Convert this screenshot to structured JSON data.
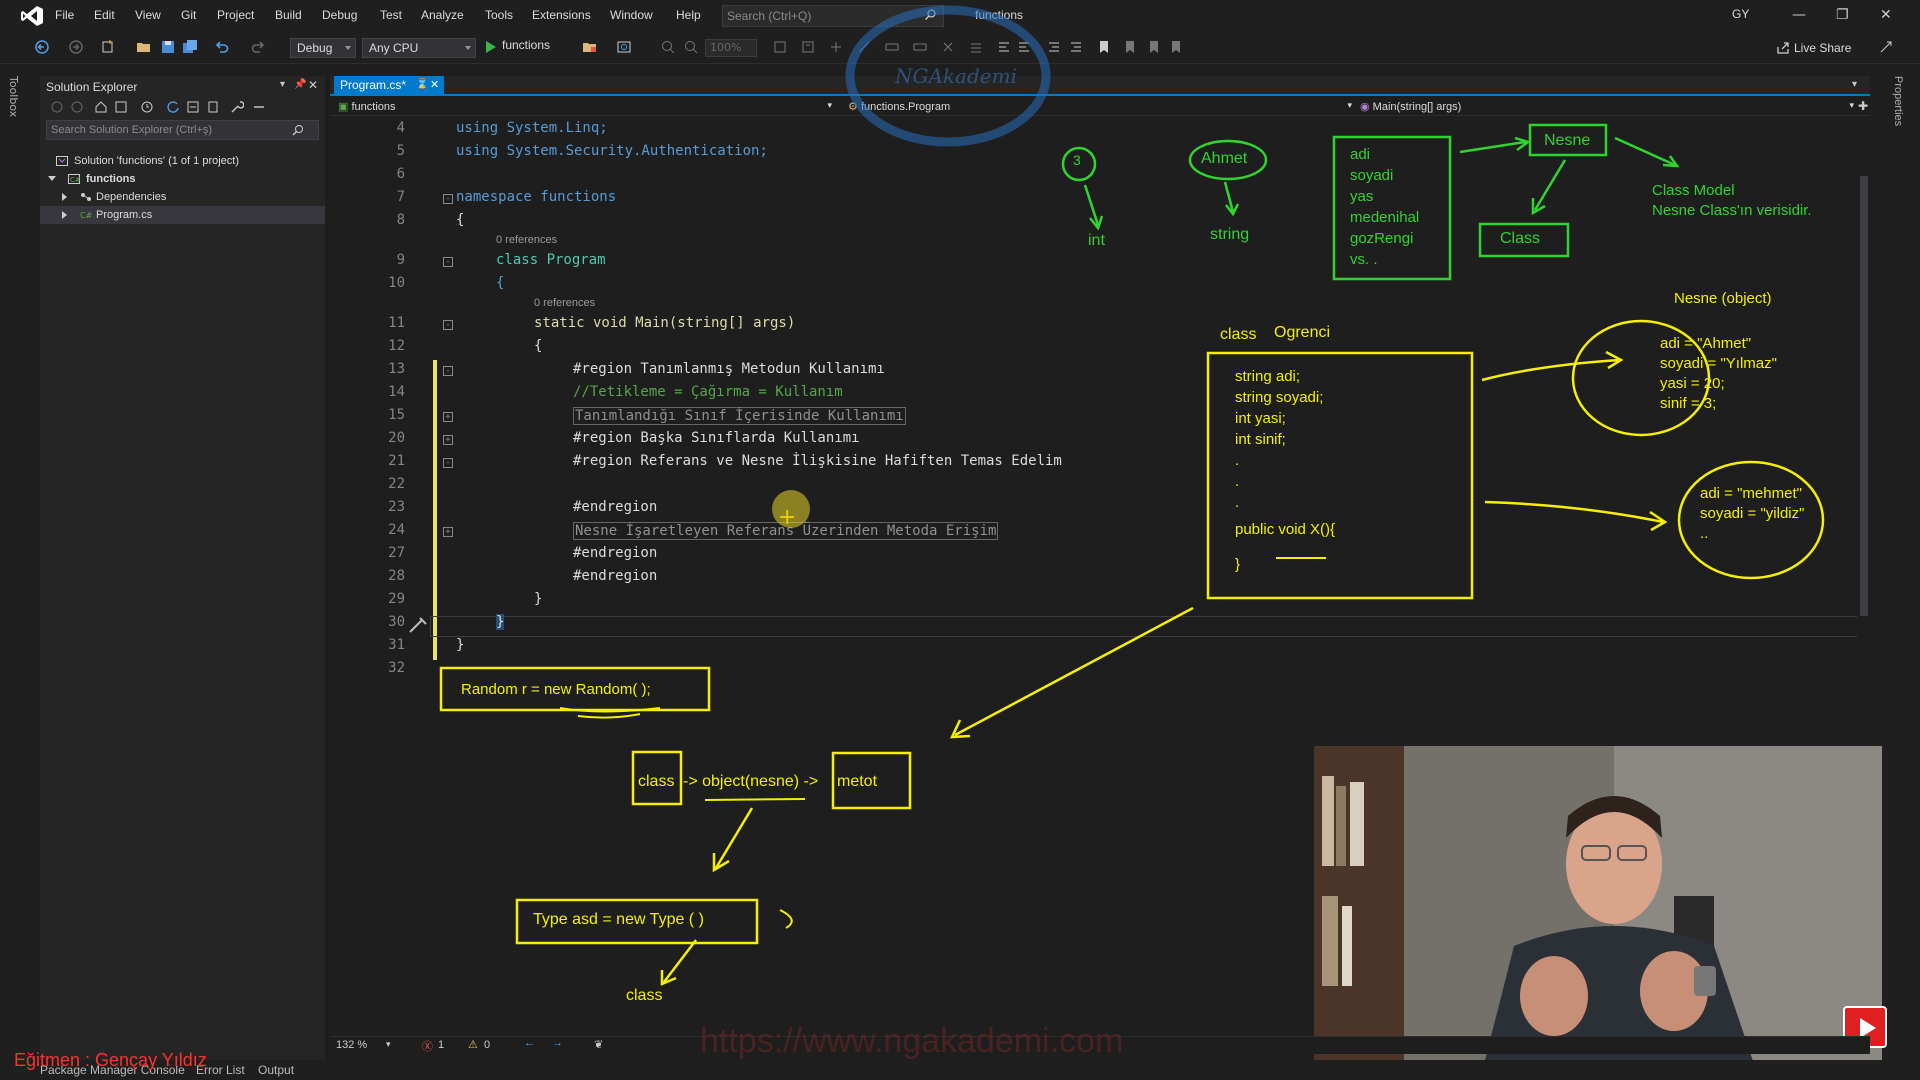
{
  "app": {
    "solution_name": "functions",
    "search_placeholder": "Search (Ctrl+Q)",
    "user_initials": "GY",
    "live_share": "Live Share"
  },
  "menu": [
    "File",
    "Edit",
    "View",
    "Git",
    "Project",
    "Build",
    "Debug",
    "Test",
    "Analyze",
    "Tools",
    "Extensions",
    "Window",
    "Help"
  ],
  "toolbar": {
    "config": "Debug",
    "platform": "Any CPU",
    "run_target": "functions",
    "zoom": "100%"
  },
  "sidebar": {
    "toolbox_label": "Toolbox",
    "properties_label": "Properties",
    "title": "Solution Explorer",
    "search_placeholder": "Search Solution Explorer (Ctrl+ş)",
    "tree": [
      {
        "label": "Solution 'functions' (1 of 1 project)"
      },
      {
        "label": "functions"
      },
      {
        "label": "Dependencies"
      },
      {
        "label": "Program.cs"
      }
    ]
  },
  "editor": {
    "tab": "Program.cs*",
    "nav_project": "functions",
    "nav_class": "functions.Program",
    "nav_member": "Main(string[] args)",
    "lines": [
      {
        "no": "4",
        "text": "using System.Linq;"
      },
      {
        "no": "5",
        "text": "using System.Security.Authentication;"
      },
      {
        "no": "6",
        "text": ""
      },
      {
        "no": "7",
        "text": "namespace functions"
      },
      {
        "no": "8",
        "text": "{"
      },
      {
        "no": "9",
        "text": "class Program"
      },
      {
        "no": "10",
        "text": "{"
      },
      {
        "no": "11",
        "text": "static void Main(string[] args)"
      },
      {
        "no": "12",
        "text": "{"
      },
      {
        "no": "13",
        "text": "#region Tanımlanmış Metodun Kullanımı"
      },
      {
        "no": "14",
        "text": "//Tetikleme = Çağırma = Kullanım"
      },
      {
        "no": "15",
        "text": "Tanımlandığı Sınıf İçerisinde Kullanımı"
      },
      {
        "no": "20",
        "text": "#region Başka Sınıflarda Kullanımı"
      },
      {
        "no": "21",
        "text": "#region Referans ve Nesne İlişkisine Hafiften Temas Edelim"
      },
      {
        "no": "22",
        "text": ""
      },
      {
        "no": "23",
        "text": "#endregion"
      },
      {
        "no": "24",
        "text": "Nesne İşaretleyen Referans Üzerinden Metoda Erişim"
      },
      {
        "no": "27",
        "text": "#endregion"
      },
      {
        "no": "28",
        "text": "#endregion"
      },
      {
        "no": "29",
        "text": "}"
      },
      {
        "no": "30",
        "text": "}"
      },
      {
        "no": "31",
        "text": "}"
      },
      {
        "no": "32",
        "text": ""
      }
    ],
    "references_label": "0 references"
  },
  "status": {
    "zoom": "132 %",
    "errors": "1",
    "warnings": "0"
  },
  "bottom_tabs": [
    "Package Manager Console",
    "Error List",
    "Output"
  ],
  "annotations": {
    "green": {
      "three": "3",
      "int": "int",
      "ahmet": "Ahmet",
      "string": "string",
      "fields": [
        "adi",
        "soyadi",
        "yas",
        "medenihal",
        "gozRengi",
        "vs.      ."
      ],
      "nesne": "Nesne",
      "class": "Class",
      "model_line1": "Class Model",
      "model_line2": "Nesne Class'ın verisidir."
    },
    "yellow": {
      "nesne_object": "Nesne  (object)",
      "class_word": "class",
      "class_name": "Ogrenci",
      "class_body": [
        "string adi;",
        "string soyadi;",
        "int yasi;",
        "int sinif;",
        ".",
        ".",
        ".",
        "public void X(){",
        "}"
      ],
      "obj1": [
        "adi = \"Ahmet\"",
        "soyadi = \"Yılmaz\"",
        "yasi = 20;",
        "sinif = 3;"
      ],
      "obj2": [
        "adi = \"mehmet\"",
        "soyadi = \"yildiz\"",
        ".."
      ],
      "random": "Random r = new Random( );",
      "flow_class": "class",
      "flow_object": "-> object(nesne) ->",
      "flow_metot": "metot",
      "type_line": "Type asd   =   new Type ( )",
      "bottom_class": "class"
    }
  },
  "branding": {
    "instructor": "Eğitmen : Gençay Yıldız",
    "watermark": "https://www.ngakademi.com",
    "logo_text": "NGAkademi"
  },
  "colors": {
    "accent": "#007acc",
    "green_ink": "#30d430",
    "yellow_ink": "#f4f000",
    "youtube_red": "#e02020"
  }
}
